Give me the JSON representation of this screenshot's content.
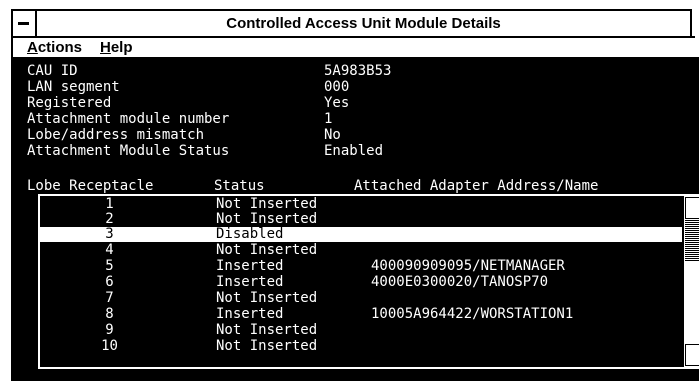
{
  "window": {
    "title": "Controlled Access Unit Module Details"
  },
  "menu": {
    "actions": "Actions",
    "actions_mnemonic": "A",
    "actions_rest": "ctions",
    "help": "Help",
    "help_mnemonic": "H",
    "help_rest": "elp"
  },
  "fields": [
    {
      "label": "CAU ID",
      "value": "5A983B53"
    },
    {
      "label": "LAN segment",
      "value": "000"
    },
    {
      "label": "Registered",
      "value": "Yes"
    },
    {
      "label": "Attachment module number",
      "value": "1"
    },
    {
      "label": "Lobe/address mismatch",
      "value": "No"
    },
    {
      "label": "Attachment Module Status",
      "value": "Enabled"
    }
  ],
  "table": {
    "headers": [
      "Lobe Receptacle",
      "Status",
      "Attached Adapter Address/Name"
    ],
    "rows": [
      {
        "lobe": "1",
        "status": "Not Inserted",
        "address": ""
      },
      {
        "lobe": "2",
        "status": "Not Inserted",
        "address": ""
      },
      {
        "lobe": "3",
        "status": "Disabled",
        "address": "",
        "selected": true
      },
      {
        "lobe": "4",
        "status": "Not Inserted",
        "address": ""
      },
      {
        "lobe": "5",
        "status": "Inserted",
        "address": "400090909095/NETMANAGER"
      },
      {
        "lobe": "6",
        "status": "Inserted",
        "address": "4000E0300020/TANOSP70"
      },
      {
        "lobe": "7",
        "status": "Not Inserted",
        "address": ""
      },
      {
        "lobe": "8",
        "status": "Inserted",
        "address": "10005A964422/WORSTATION1"
      },
      {
        "lobe": "9",
        "status": "Not Inserted",
        "address": ""
      },
      {
        "lobe": "10",
        "status": "Not Inserted",
        "address": ""
      }
    ]
  },
  "icons": {
    "system_menu": "system-menu-icon",
    "scroll_up": "scroll-up-icon",
    "scroll_down": "scroll-down-icon"
  },
  "colors": {
    "background": "#000000",
    "text": "#ffffff",
    "selection": "#ffffff"
  }
}
